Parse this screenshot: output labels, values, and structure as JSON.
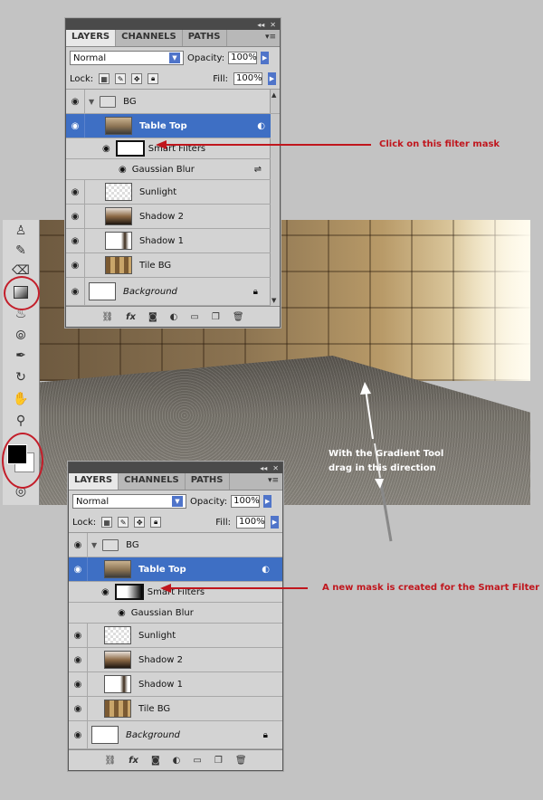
{
  "tabs": [
    "LAYERS",
    "CHANNELS",
    "PATHS"
  ],
  "blend_mode": "Normal",
  "opacity_label": "Opacity:",
  "opacity_value": "100%",
  "lock_label": "Lock:",
  "fill_label": "Fill:",
  "fill_value": "100%",
  "layers": {
    "bg_group": "BG",
    "table_top": "Table Top",
    "smart_filters": "Smart Filters",
    "gaussian_blur": "Gaussian Blur",
    "sunlight": "Sunlight",
    "shadow2": "Shadow 2",
    "shadow1": "Shadow 1",
    "tile_bg": "Tile BG",
    "background": "Background"
  },
  "annotations": {
    "click_mask": "Click on this filter mask",
    "gradient_line1": "With the Gradient Tool",
    "gradient_line2": "drag in this direction",
    "new_mask": "A new mask is created for the Smart Filter"
  },
  "colors": {
    "selection": "#3e6fc4",
    "annotation_red": "#c0161d"
  }
}
